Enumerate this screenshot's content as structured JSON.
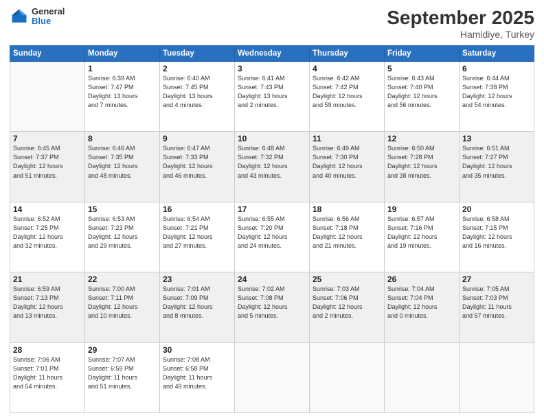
{
  "header": {
    "logo_general": "General",
    "logo_blue": "Blue",
    "title": "September 2025",
    "location": "Hamidiye, Turkey"
  },
  "weekdays": [
    "Sunday",
    "Monday",
    "Tuesday",
    "Wednesday",
    "Thursday",
    "Friday",
    "Saturday"
  ],
  "weeks": [
    [
      {
        "day": "",
        "info": ""
      },
      {
        "day": "1",
        "info": "Sunrise: 6:39 AM\nSunset: 7:47 PM\nDaylight: 13 hours\nand 7 minutes."
      },
      {
        "day": "2",
        "info": "Sunrise: 6:40 AM\nSunset: 7:45 PM\nDaylight: 13 hours\nand 4 minutes."
      },
      {
        "day": "3",
        "info": "Sunrise: 6:41 AM\nSunset: 7:43 PM\nDaylight: 13 hours\nand 2 minutes."
      },
      {
        "day": "4",
        "info": "Sunrise: 6:42 AM\nSunset: 7:42 PM\nDaylight: 12 hours\nand 59 minutes."
      },
      {
        "day": "5",
        "info": "Sunrise: 6:43 AM\nSunset: 7:40 PM\nDaylight: 12 hours\nand 56 minutes."
      },
      {
        "day": "6",
        "info": "Sunrise: 6:44 AM\nSunset: 7:38 PM\nDaylight: 12 hours\nand 54 minutes."
      }
    ],
    [
      {
        "day": "7",
        "info": "Sunrise: 6:45 AM\nSunset: 7:37 PM\nDaylight: 12 hours\nand 51 minutes."
      },
      {
        "day": "8",
        "info": "Sunrise: 6:46 AM\nSunset: 7:35 PM\nDaylight: 12 hours\nand 48 minutes."
      },
      {
        "day": "9",
        "info": "Sunrise: 6:47 AM\nSunset: 7:33 PM\nDaylight: 12 hours\nand 46 minutes."
      },
      {
        "day": "10",
        "info": "Sunrise: 6:48 AM\nSunset: 7:32 PM\nDaylight: 12 hours\nand 43 minutes."
      },
      {
        "day": "11",
        "info": "Sunrise: 6:49 AM\nSunset: 7:30 PM\nDaylight: 12 hours\nand 40 minutes."
      },
      {
        "day": "12",
        "info": "Sunrise: 6:50 AM\nSunset: 7:28 PM\nDaylight: 12 hours\nand 38 minutes."
      },
      {
        "day": "13",
        "info": "Sunrise: 6:51 AM\nSunset: 7:27 PM\nDaylight: 12 hours\nand 35 minutes."
      }
    ],
    [
      {
        "day": "14",
        "info": "Sunrise: 6:52 AM\nSunset: 7:25 PM\nDaylight: 12 hours\nand 32 minutes."
      },
      {
        "day": "15",
        "info": "Sunrise: 6:53 AM\nSunset: 7:23 PM\nDaylight: 12 hours\nand 29 minutes."
      },
      {
        "day": "16",
        "info": "Sunrise: 6:54 AM\nSunset: 7:21 PM\nDaylight: 12 hours\nand 27 minutes."
      },
      {
        "day": "17",
        "info": "Sunrise: 6:55 AM\nSunset: 7:20 PM\nDaylight: 12 hours\nand 24 minutes."
      },
      {
        "day": "18",
        "info": "Sunrise: 6:56 AM\nSunset: 7:18 PM\nDaylight: 12 hours\nand 21 minutes."
      },
      {
        "day": "19",
        "info": "Sunrise: 6:57 AM\nSunset: 7:16 PM\nDaylight: 12 hours\nand 19 minutes."
      },
      {
        "day": "20",
        "info": "Sunrise: 6:58 AM\nSunset: 7:15 PM\nDaylight: 12 hours\nand 16 minutes."
      }
    ],
    [
      {
        "day": "21",
        "info": "Sunrise: 6:59 AM\nSunset: 7:13 PM\nDaylight: 12 hours\nand 13 minutes."
      },
      {
        "day": "22",
        "info": "Sunrise: 7:00 AM\nSunset: 7:11 PM\nDaylight: 12 hours\nand 10 minutes."
      },
      {
        "day": "23",
        "info": "Sunrise: 7:01 AM\nSunset: 7:09 PM\nDaylight: 12 hours\nand 8 minutes."
      },
      {
        "day": "24",
        "info": "Sunrise: 7:02 AM\nSunset: 7:08 PM\nDaylight: 12 hours\nand 5 minutes."
      },
      {
        "day": "25",
        "info": "Sunrise: 7:03 AM\nSunset: 7:06 PM\nDaylight: 12 hours\nand 2 minutes."
      },
      {
        "day": "26",
        "info": "Sunrise: 7:04 AM\nSunset: 7:04 PM\nDaylight: 12 hours\nand 0 minutes."
      },
      {
        "day": "27",
        "info": "Sunrise: 7:05 AM\nSunset: 7:03 PM\nDaylight: 11 hours\nand 57 minutes."
      }
    ],
    [
      {
        "day": "28",
        "info": "Sunrise: 7:06 AM\nSunset: 7:01 PM\nDaylight: 11 hours\nand 54 minutes."
      },
      {
        "day": "29",
        "info": "Sunrise: 7:07 AM\nSunset: 6:59 PM\nDaylight: 11 hours\nand 51 minutes."
      },
      {
        "day": "30",
        "info": "Sunrise: 7:08 AM\nSunset: 6:58 PM\nDaylight: 11 hours\nand 49 minutes."
      },
      {
        "day": "",
        "info": ""
      },
      {
        "day": "",
        "info": ""
      },
      {
        "day": "",
        "info": ""
      },
      {
        "day": "",
        "info": ""
      }
    ]
  ]
}
